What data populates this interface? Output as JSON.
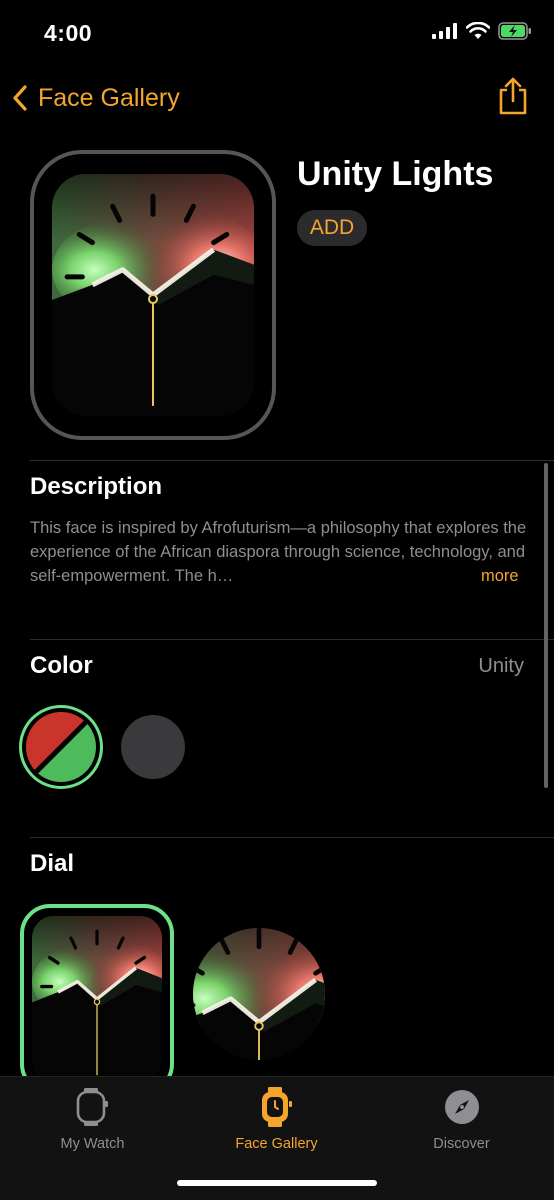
{
  "status": {
    "time": "4:00"
  },
  "nav": {
    "back_label": "Face Gallery"
  },
  "face": {
    "title": "Unity Lights",
    "add_label": "ADD"
  },
  "description": {
    "heading": "Description",
    "text": "This face is inspired by Afrofuturism—a philosophy that explores the experience of the African diaspora through science, technology, and self-empowerment. The h…",
    "more_label": "more"
  },
  "color": {
    "heading": "Color",
    "value": "Unity",
    "swatches": [
      "unity",
      "gray"
    ],
    "colors": {
      "red": "#c9342b",
      "green": "#4dba5b",
      "selection_ring": "#6de18a"
    }
  },
  "dial": {
    "heading": "Dial",
    "options": [
      "rectangular",
      "circular"
    ]
  },
  "tabs": [
    {
      "label": "My Watch",
      "icon": "watch-outline-icon",
      "active": false
    },
    {
      "label": "Face Gallery",
      "icon": "watch-face-icon",
      "active": true
    },
    {
      "label": "Discover",
      "icon": "compass-icon",
      "active": false
    }
  ],
  "theme": {
    "accent": "#f4a52d",
    "inactive": "#8e8e93"
  }
}
